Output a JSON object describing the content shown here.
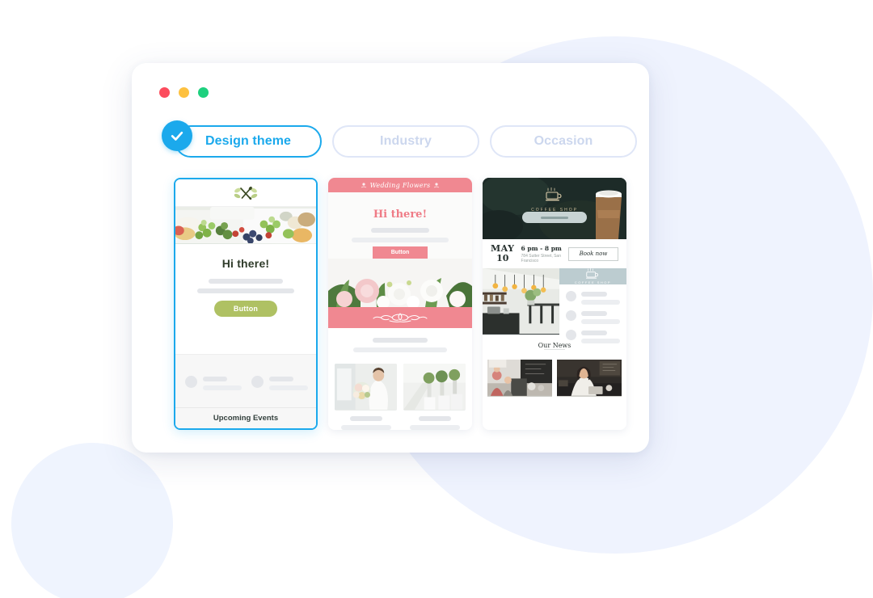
{
  "window": {
    "traffic_lights": [
      {
        "name": "close",
        "color": "#fc4c5d"
      },
      {
        "name": "minimize",
        "color": "#fdc140"
      },
      {
        "name": "maximize",
        "color": "#1ed07e"
      }
    ]
  },
  "tabs": [
    {
      "label": "Design theme",
      "active": true
    },
    {
      "label": "Industry",
      "active": false
    },
    {
      "label": "Occasion",
      "active": false
    }
  ],
  "theme": {
    "accent": "#1ba9ec",
    "inactive_border": "#dfe6f7",
    "inactive_text": "#ccd7ee",
    "background_circle": "#eff3fe"
  },
  "templates": [
    {
      "id": "restaurant",
      "selected": true,
      "selected_icon": "check-circle-icon",
      "logo_icon": "fork-spoon-icon",
      "heading": "Hi there!",
      "button_label": "Button",
      "button_color": "#afc163",
      "footer_heading": "Upcoming Events",
      "hero_alt": "meal prep containers with rice, cucumber, tomatoes and greens"
    },
    {
      "id": "wedding-flowers",
      "selected": false,
      "banner_title": "Wedding Flowers",
      "banner_color": "#f08891",
      "heading": "Hi there!",
      "button_label": "Button",
      "divider_icon": "floral-ornament-icon",
      "hero_alt": "pink and white dahlias with green foliage",
      "gallery": [
        {
          "alt": "bride holding bouquet"
        },
        {
          "alt": "wedding aisle chairs with greenery"
        }
      ]
    },
    {
      "id": "coffee-shop",
      "selected": false,
      "logo_icon": "coffee-cup-icon",
      "logo_text": "COFFEE SHOP",
      "hero_alt": "takeaway coffee cup on dark green background",
      "event": {
        "month": "MAY",
        "day": "10",
        "time": "6 pm - 8 pm",
        "address": "784 Sutter Street, San Francisco",
        "book_label": "Book now"
      },
      "badge_text": "COFFEE SHOP",
      "photo_alt": "cafe interior with pendant lights and bar",
      "news_heading": "Our News",
      "news": [
        {
          "alt": "barista serving customers at counter"
        },
        {
          "alt": "woman with laptop in cafe"
        }
      ]
    }
  ]
}
